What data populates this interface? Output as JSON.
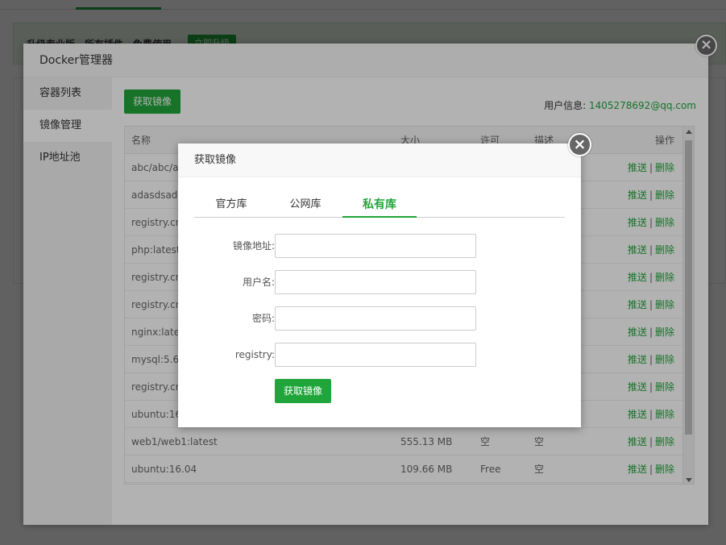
{
  "background": {
    "notice_text": "升级专业版，所有插件，免费使用。",
    "notice_button": "立即升级"
  },
  "window": {
    "title": "Docker管理器",
    "close_symbol": "×"
  },
  "sidebar": {
    "items": [
      {
        "label": "容器列表"
      },
      {
        "label": "镜像管理"
      },
      {
        "label": "IP地址池"
      }
    ]
  },
  "toolbar": {
    "get_image_label": "获取镜像",
    "user_info_label": "用户信息: ",
    "user_email": "1405278692@qq.com"
  },
  "table": {
    "headers": {
      "name": "名称",
      "size": "大小",
      "license": "许可",
      "desc": "描述",
      "ops": "操作"
    },
    "push_label": "推送",
    "sep": "|",
    "delete_label": "删除",
    "rows": [
      {
        "name": "abc/abc/a",
        "size": "",
        "license": "",
        "desc": ""
      },
      {
        "name": "adasdsads",
        "size": "",
        "license": "",
        "desc": ""
      },
      {
        "name": "registry.cn",
        "size": "",
        "license": "",
        "desc": ""
      },
      {
        "name": "php:latest",
        "size": "",
        "license": "",
        "desc": ""
      },
      {
        "name": "registry.cn",
        "size": "",
        "license": "",
        "desc": ""
      },
      {
        "name": "registry.cn",
        "size": "",
        "license": "",
        "desc": ""
      },
      {
        "name": "nginx:lates",
        "size": "",
        "license": "",
        "desc": ""
      },
      {
        "name": "mysql:5.6",
        "size": "",
        "license": "",
        "desc": ""
      },
      {
        "name": "registry.cn",
        "size": "",
        "license": "",
        "desc": ""
      },
      {
        "name": "ubuntu:16.",
        "size": "",
        "license": "",
        "desc": ""
      },
      {
        "name": "web1/web1:latest",
        "size": "555.13 MB",
        "license": "空",
        "desc": "空"
      },
      {
        "name": "ubuntu:16.04",
        "size": "109.66 MB",
        "license": "Free",
        "desc": "空"
      }
    ]
  },
  "dialog": {
    "title": "获取镜像",
    "close_symbol": "×",
    "tabs": [
      {
        "label": "官方库"
      },
      {
        "label": "公网库"
      },
      {
        "label": "私有库"
      }
    ],
    "fields": [
      {
        "label": "镜像地址:",
        "value": ""
      },
      {
        "label": "用户名:",
        "value": ""
      },
      {
        "label": "密码:",
        "value": ""
      },
      {
        "label": "registry:",
        "value": ""
      }
    ],
    "submit_label": "获取镜像"
  },
  "colors": {
    "accent": "#20a53a"
  }
}
